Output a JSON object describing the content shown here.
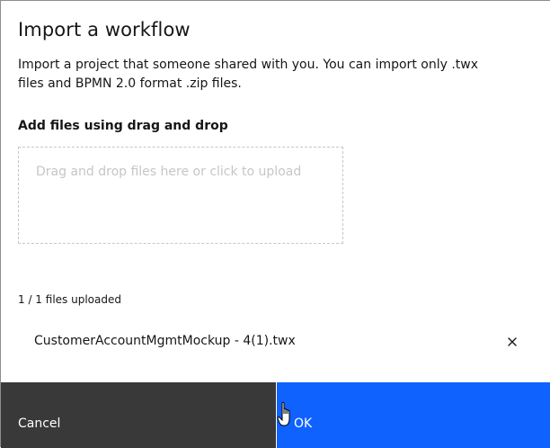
{
  "modal": {
    "title": "Import a workflow",
    "description": "Import a project that someone shared with you. You can import only .twx files and BPMN 2.0 format .zip files."
  },
  "upload": {
    "section_label": "Add files using drag and drop",
    "dropzone_text": "Drag and drop files here or click to upload",
    "status": "1 / 1 files uploaded",
    "files": [
      {
        "name": "CustomerAccountMgmtMockup - 4(1).twx"
      }
    ]
  },
  "footer": {
    "cancel_label": "Cancel",
    "ok_label": "OK"
  },
  "icons": {
    "remove": "close-icon",
    "cursor": "hand-pointer-icon"
  },
  "colors": {
    "primary": "#0f62fe",
    "secondary": "#393939",
    "placeholder": "#c6c6c6"
  }
}
